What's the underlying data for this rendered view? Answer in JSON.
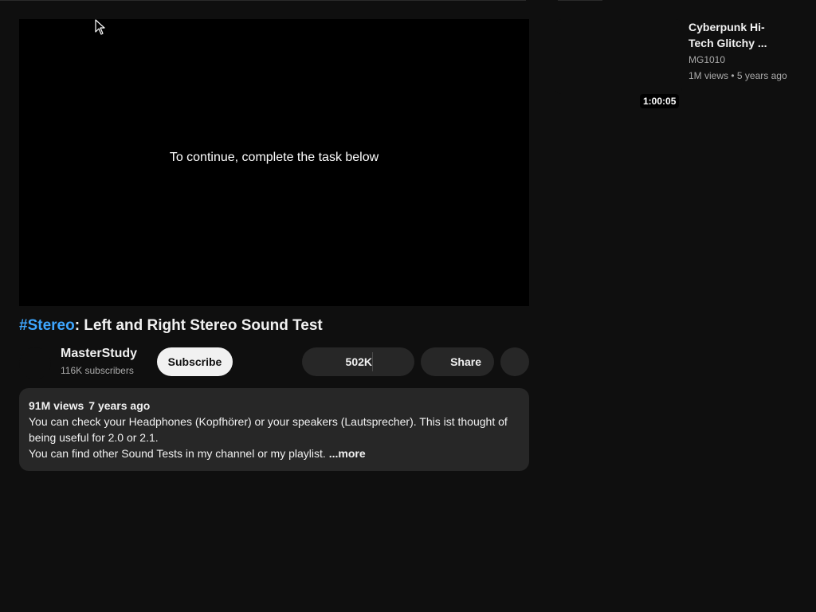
{
  "player": {
    "message": "To continue, complete the task below"
  },
  "video": {
    "title_hashtag": "#Stereo",
    "title_rest": ": Left and Right Stereo Sound Test"
  },
  "channel": {
    "name": "MasterStudy",
    "subscribers": "116K subscribers",
    "subscribe_label": "Subscribe"
  },
  "actions": {
    "like_count": "502K",
    "share_label": "Share"
  },
  "description": {
    "views": "91M views",
    "age": "7 years ago",
    "line1": "You can check your Headphones (Kopfhörer) or your speakers (Lautsprecher). This ist thought of being useful for 2.0 or 2.1.",
    "line2": "You can find other Sound Tests in my channel or my playlist.",
    "more_label": "...more"
  },
  "recommendation": {
    "duration": "1:00:05",
    "title": "Cyberpunk Hi-Tech Glitchy ...",
    "channel": "MG1010",
    "views": "1M views",
    "separator": "•",
    "age": "5 years ago"
  },
  "colors": {
    "background": "#0f0f0f",
    "surface": "#272727",
    "hashtag": "#3ea6ff",
    "text_primary": "#f1f1f1",
    "text_secondary": "#aaaaaa"
  }
}
